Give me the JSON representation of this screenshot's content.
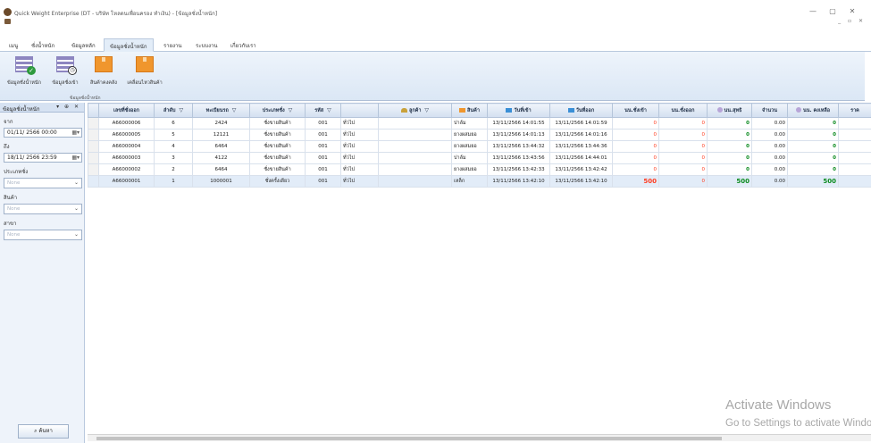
{
  "window": {
    "title": "Quick Weight Enterprise (DT - บริษัท โหลดนเพื่อนครอง ทำเงิน) - [ข้อมูลชั่งน้ำหนัก]",
    "minimize": "—",
    "maximize": "▢",
    "close": "✕",
    "mdi_controls": "_ ▫ ✕"
  },
  "ribbon": {
    "tabs": [
      "เมนู",
      "ชั่งน้ำหนัก",
      "ข้อมูลหลัก",
      "ข้อมูลชั่งน้ำหนัก",
      "รายงาน",
      "ระบบงาน",
      "เกี่ยวกับเรา"
    ],
    "active_tab": 3,
    "buttons": [
      {
        "label": "ข้อมูลชั่งน้ำหนัก",
        "icon": "weigh-list-check-icon"
      },
      {
        "label": "ข้อมูลชั่งเข้า",
        "icon": "weigh-in-clock-icon"
      },
      {
        "label": "สินค้าคงคลัง",
        "icon": "inventory-box-icon"
      },
      {
        "label": "เคลื่อนไหวสินค้า",
        "icon": "product-movement-box-icon"
      }
    ],
    "group_caption": "ข้อมูลชั่งน้ำหนัก"
  },
  "filter_panel": {
    "title": "ข้อมูลชั่งน้ำหนัก",
    "panel_controls": "▾ ⊕ ✕",
    "from_label": "จาก",
    "from_value": "01/11/  2566 00:00",
    "to_label": "ถึง",
    "to_value": "18/11/  2566 23:59",
    "weigh_type_label": "ประเภทชั่ง",
    "weigh_type_value": "None",
    "product_label": "สินค้า",
    "product_value": "None",
    "branch_label": "สาขา",
    "branch_value": "None",
    "search_label": "ค้นหา"
  },
  "grid": {
    "columns": [
      "",
      "เลขที่ชั่งออก",
      "ลำดับ",
      "ทะเบียนรถ",
      "ประเภทชั่ง",
      "รหัส",
      "",
      "ลูกค้า",
      "สินค้า",
      "วันที่เข้า",
      "วันที่ออก",
      "นน.ชั่งเข้า",
      "นน.ชั่งออก",
      "นน.สุทธิ",
      "จำนวน",
      "นน. คงเหลือ",
      "ราค"
    ],
    "rows": [
      {
        "doc_no": "A66000006",
        "seq": "6",
        "plate": "2424",
        "type": "ชั่งขายสินค้า",
        "code": "001",
        "customer": "ทั่วไป",
        "product": "ปาล์ม",
        "date_in": "13/11/2566 14:01:55",
        "date_out": "13/11/2566 14:01:59",
        "w_in": "0",
        "w_out": "0",
        "net": "0",
        "qty": "0.00",
        "remain": "0"
      },
      {
        "doc_no": "A66000005",
        "seq": "5",
        "plate": "12121",
        "type": "ชั่งขายสินค้า",
        "code": "001",
        "customer": "ทั่วไป",
        "product": "ยางผสมยอ",
        "date_in": "13/11/2566 14:01:13",
        "date_out": "13/11/2566 14:01:16",
        "w_in": "0",
        "w_out": "0",
        "net": "0",
        "qty": "0.00",
        "remain": "0"
      },
      {
        "doc_no": "A66000004",
        "seq": "4",
        "plate": "6464",
        "type": "ชั่งขายสินค้า",
        "code": "001",
        "customer": "ทั่วไป",
        "product": "ยางผสมยอ",
        "date_in": "13/11/2566 13:44:32",
        "date_out": "13/11/2566 13:44:36",
        "w_in": "0",
        "w_out": "0",
        "net": "0",
        "qty": "0.00",
        "remain": "0"
      },
      {
        "doc_no": "A66000003",
        "seq": "3",
        "plate": "4122",
        "type": "ชั่งขายสินค้า",
        "code": "001",
        "customer": "ทั่วไป",
        "product": "ปาล์ม",
        "date_in": "13/11/2566 13:43:56",
        "date_out": "13/11/2566 14:44:01",
        "w_in": "0",
        "w_out": "0",
        "net": "0",
        "qty": "0.00",
        "remain": "0"
      },
      {
        "doc_no": "A66000002",
        "seq": "2",
        "plate": "6464",
        "type": "ชั่งขายสินค้า",
        "code": "001",
        "customer": "ทั่วไป",
        "product": "ยางผสมยอ",
        "date_in": "13/11/2566 13:42:33",
        "date_out": "13/11/2566 13:42:42",
        "w_in": "0",
        "w_out": "0",
        "net": "0",
        "qty": "0.00",
        "remain": "0"
      },
      {
        "doc_no": "A66000001",
        "seq": "1",
        "plate": "1000001",
        "type": "ชั่งครั้งเดียว",
        "code": "001",
        "customer": "ทั่วไป",
        "product": "เหล็ก",
        "date_in": "13/11/2566 13:42:10",
        "date_out": "13/11/2566 13:42:10",
        "w_in": "500",
        "w_out": "0",
        "net": "500",
        "qty": "0.00",
        "remain": "500"
      }
    ]
  },
  "watermark": {
    "line1": "Activate Windows",
    "line2": "Go to Settings to activate Windows."
  },
  "colors": {
    "ribbon_bg": "#dbe7f5",
    "weight_in_red": "#ff3b1f",
    "net_green": "#0a8a1e",
    "accent_orange": "#f0962d"
  }
}
